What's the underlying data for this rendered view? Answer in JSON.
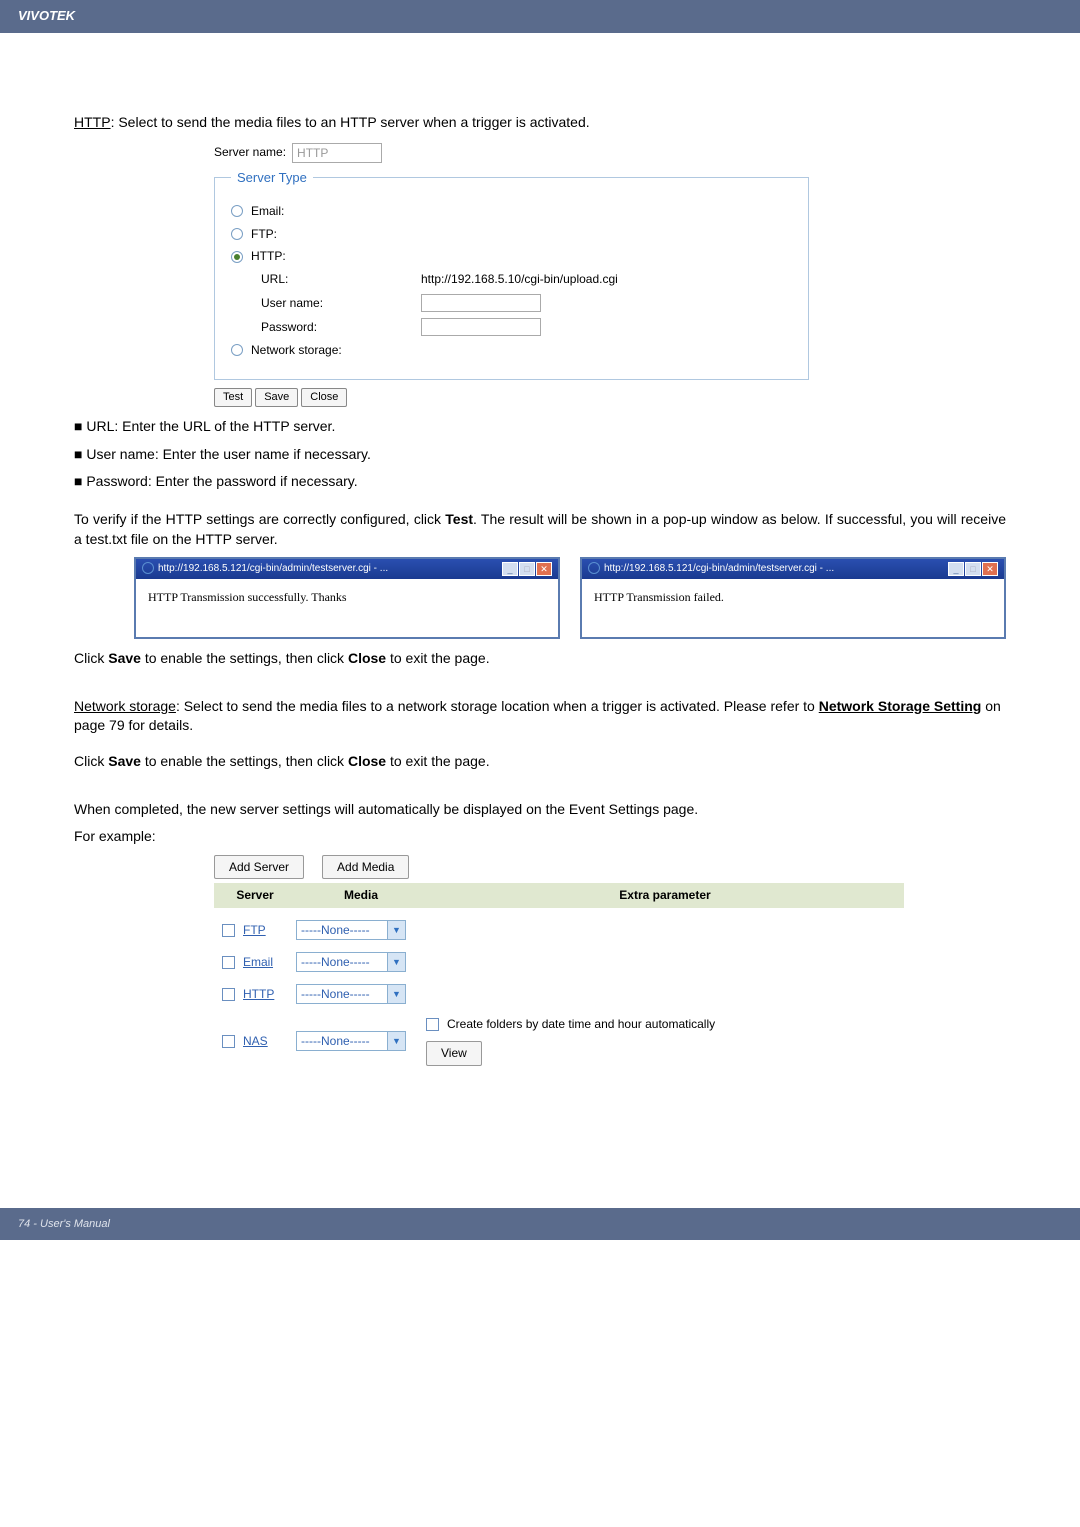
{
  "header": {
    "brand": "VIVOTEK"
  },
  "intro": {
    "http_label": "HTTP",
    "http_desc": ": Select to send the media files to an HTTP server when a trigger is activated."
  },
  "serverForm": {
    "serverNameLabel": "Server name:",
    "serverNameValue": "HTTP",
    "legend": "Server Type",
    "email": "Email:",
    "ftp": "FTP:",
    "http": "HTTP:",
    "urlLabel": "URL:",
    "urlValue": "http://192.168.5.10/cgi-bin/upload.cgi",
    "userLabel": "User name:",
    "passLabel": "Password:",
    "network": "Network storage:",
    "test": "Test",
    "save": "Save",
    "close": "Close"
  },
  "bullets": {
    "url": "■ URL: Enter the URL of the HTTP server.",
    "user": "■ User name: Enter the user name if necessary.",
    "pass": "■ Password: Enter the password if necessary."
  },
  "verify": {
    "text_a": "To verify if the HTTP settings are correctly configured, click ",
    "test": "Test",
    "text_b": ". The result will be shown in a pop-up window as below. If successful, you will receive a test.txt file on the HTTP server."
  },
  "popups": {
    "title": "http://192.168.5.121/cgi-bin/admin/testserver.cgi - ...",
    "success": "HTTP Transmission successfully. Thanks",
    "fail": "HTTP Transmission failed."
  },
  "save_close": {
    "a": "Click ",
    "save": "Save",
    "b": " to enable the settings, then click ",
    "close": "Close",
    "c": " to exit the page."
  },
  "network_storage": {
    "label": "Network storage",
    "text": ": Select to send the media files to a network storage location when a trigger is activated. Please refer to ",
    "link": "Network Storage Setting",
    "suffix": " on page 79 for details."
  },
  "completed": {
    "line1": "When completed, the new server settings will automatically be displayed on the Event Settings page.",
    "line2": "For example:"
  },
  "eventTable": {
    "addServer": "Add Server",
    "addMedia": "Add Media",
    "hServer": "Server",
    "hMedia": "Media",
    "hExtra": "Extra parameter",
    "none": "-----None-----",
    "rows": {
      "ftp": "FTP",
      "email": "Email",
      "http": "HTTP",
      "nas": "NAS"
    },
    "nasCreate": "Create folders by date time and hour automatically",
    "nasView": "View"
  },
  "footer": {
    "pageLabel": "74 - User's Manual"
  }
}
